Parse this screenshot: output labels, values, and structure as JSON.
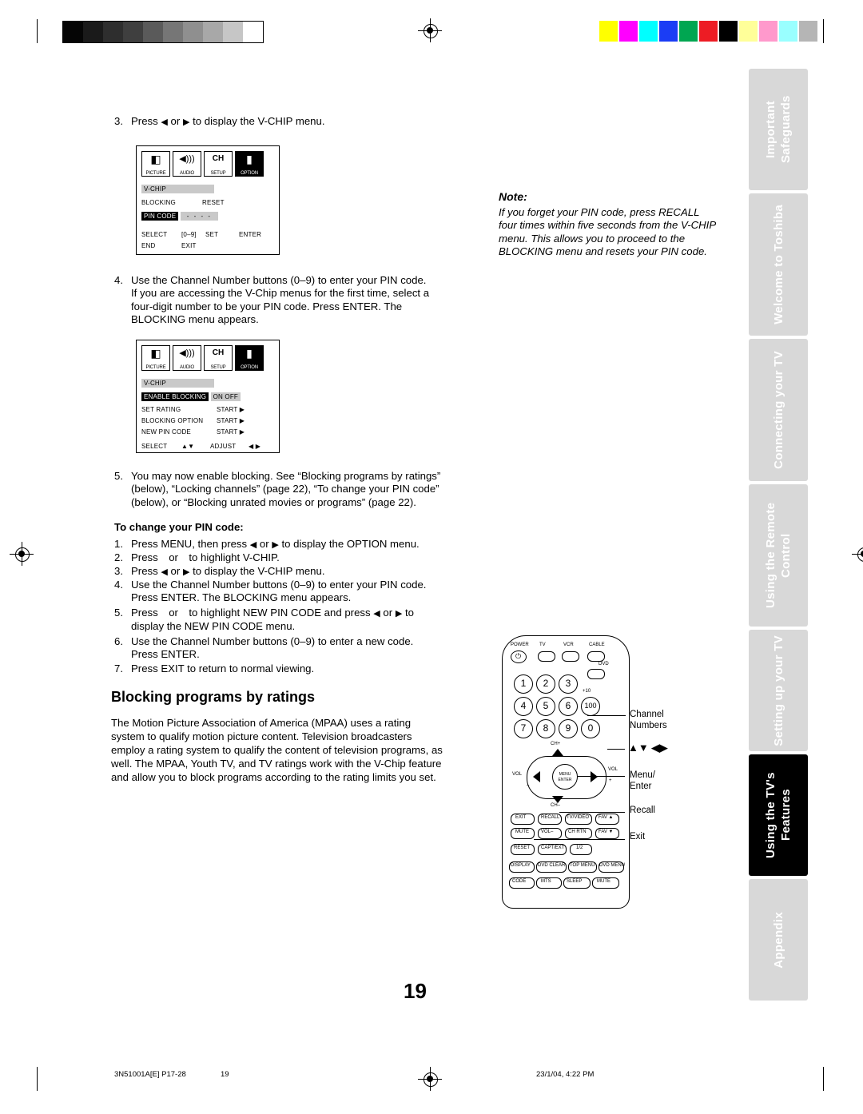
{
  "page": {
    "number": "19",
    "footer_left": "3N51001A[E] P17-28",
    "footer_center": "19",
    "footer_right": "23/1/04, 4:22 PM"
  },
  "side_tabs": [
    {
      "lines": "Important\nSafeguards",
      "dark": false
    },
    {
      "lines": "Welcome to\nToshiba",
      "dark": false
    },
    {
      "lines": "Connecting\nyour TV",
      "dark": false
    },
    {
      "lines": "Using the\nRemote Control",
      "dark": false
    },
    {
      "lines": "Setting up\nyour TV",
      "dark": false
    },
    {
      "lines": "Using the TV's\nFeatures",
      "dark": true
    },
    {
      "lines": "Appendix",
      "dark": false
    }
  ],
  "steps": {
    "s3_num": "3.",
    "s3_text_a": "Press",
    "s3_text_b": "or",
    "s3_text_c": "to display the V-CHIP menu.",
    "s4_num": "4.",
    "s4_text": "Use the Channel Number buttons (0–9) to enter your PIN code.\nIf you are accessing the V-Chip menus for the first time, select a\nfour-digit number to be your PIN code. Press ENTER. The\nBLOCKING menu appears.",
    "s5_num": "5.",
    "s5_text": "You may now enable blocking. See “Blocking programs by ratings”\n(below), “Locking channels” (page 22), “To change your PIN code”\n(below), or “Blocking unrated movies or programs” (page 22)."
  },
  "note": {
    "heading": "Note:",
    "body": "If you forget your PIN code, press RECALL\nfour times within five seconds from the V-CHIP\nmenu. This allows you to proceed to the\nBLOCKING menu and resets your PIN code."
  },
  "pin_section": {
    "heading": "To change your PIN code:",
    "items": [
      {
        "n": "1.",
        "text_a": "Press MENU, then press",
        "text_b": "or",
        "text_c": "to display the OPTION menu."
      },
      {
        "n": "2.",
        "text_a": "Press",
        "text_b": "or",
        "text_c": "to highlight V-CHIP."
      },
      {
        "n": "3.",
        "text_a": "Press",
        "text_b": "or",
        "text_c": "to display the V-CHIP menu."
      },
      {
        "n": "4.",
        "text_a": "Use the Channel Number buttons (0–9) to enter your PIN code.",
        "text_b": "Press ENTER. The BLOCKING menu appears."
      },
      {
        "n": "5.",
        "text_a": "Press",
        "text_b": "or",
        "text_c": "to highlight NEW PIN CODE and press",
        "text_d": "or",
        "text_e": "to",
        "text_f": "display the NEW PIN CODE menu."
      },
      {
        "n": "6.",
        "text_a": "Use the Channel Number buttons (0–9) to enter a new code.",
        "text_b": "Press ENTER."
      },
      {
        "n": "7.",
        "text_a": "Press EXIT to return to normal viewing."
      }
    ]
  },
  "ratings_section": {
    "heading": "Blocking programs by ratings",
    "body": "The Motion Picture Association of America (MPAA) uses a rating\nsystem to qualify motion picture content. Television broadcasters\nemploy a rating system to qualify the content of television programs, as\nwell. The MPAA, Youth TV, and TV ratings work with the V-Chip feature\nand allow you to block programs according to the rating limits you set."
  },
  "osd1": {
    "icons": [
      {
        "cap": "PICTURE",
        "glyph": "◖",
        "selected": false
      },
      {
        "cap": "AUDIO",
        "glyph": "◀))",
        "selected": false
      },
      {
        "cap": "SETUP",
        "glyph": "CH",
        "selected": false
      },
      {
        "cap": "OPTION",
        "glyph": "▮",
        "selected": true
      }
    ],
    "title": "V-CHIP",
    "row1_left": "BLOCKING",
    "row1_right": "RESET",
    "row2_left": "PIN CODE",
    "row2_dashes": "- - - -",
    "footer_a": "SELECT",
    "footer_b": "[0–9]",
    "footer_c": "SET",
    "footer_d": "ENTER",
    "footer_e": "END",
    "footer_f": "EXIT"
  },
  "osd2": {
    "icons": [
      {
        "cap": "PICTURE",
        "glyph": "◖",
        "selected": false
      },
      {
        "cap": "AUDIO",
        "glyph": "◀))",
        "selected": false
      },
      {
        "cap": "SETUP",
        "glyph": "CH",
        "selected": false
      },
      {
        "cap": "OPTION",
        "glyph": "▮",
        "selected": true
      }
    ],
    "title": "V-CHIP",
    "rows": [
      {
        "label": "ENABLE BLOCKING",
        "value": "ON  OFF",
        "highlight": true
      },
      {
        "label": "SET RATING",
        "value": "START  ▶",
        "highlight": false
      },
      {
        "label": "BLOCKING OPTION",
        "value": "START  ▶",
        "highlight": false
      },
      {
        "label": "NEW PIN CODE",
        "value": "START  ▶",
        "highlight": false
      }
    ],
    "footer_a": "SELECT",
    "footer_b": "▲▼",
    "footer_c": "ADJUST",
    "footer_d": "◀ ▶"
  },
  "remote": {
    "top_labels": [
      "POWER",
      "TV",
      "VCR",
      "CABLE",
      "DVD"
    ],
    "numbers": [
      "1",
      "2",
      "3",
      "4",
      "5",
      "6",
      "7",
      "8",
      "9",
      "0"
    ],
    "plus10": "+10",
    "hundred": "100",
    "center_label": "MENU/\nENTER",
    "vol_left": "VOL",
    "vol_right": "VOL",
    "ch_up": "CH+",
    "ch_down": "CH–",
    "minus": "–",
    "plus": "+",
    "row_a": [
      "EXIT",
      "RECALL",
      "TV/VIDEO",
      "FAV ▲"
    ],
    "row_b": [
      "MUTE",
      "VOL–",
      "CH RTN",
      "FAV ▼"
    ],
    "row_c": [
      "RESET",
      "CAPT/EXT",
      "1/2"
    ],
    "row_d": [
      "DISPLAY",
      "DVD CLEAR",
      "TOP MENU",
      "DVD MENU"
    ],
    "row_e": [
      "CODE",
      "MTS",
      "SLEEP",
      "MUTE"
    ]
  },
  "callouts": {
    "channel_numbers": "Channel\nNumbers",
    "arrows": "▲▼ ◀▶",
    "menu_enter": "Menu/\nEnter",
    "recall": "Recall",
    "exit": "Exit"
  },
  "colors": {
    "tab_gray": "#d8d8d8",
    "tab_dark": "#000000",
    "osd_gray": "#c9c9c9",
    "bar_colors": [
      "#ffff00",
      "#ff00ff",
      "#00ffff",
      "#0000ff",
      "#00a651",
      "#ed1c24",
      "#000000",
      "#ffff99",
      "#ff99cc",
      "#99ffff",
      "#b0b0b0"
    ]
  }
}
